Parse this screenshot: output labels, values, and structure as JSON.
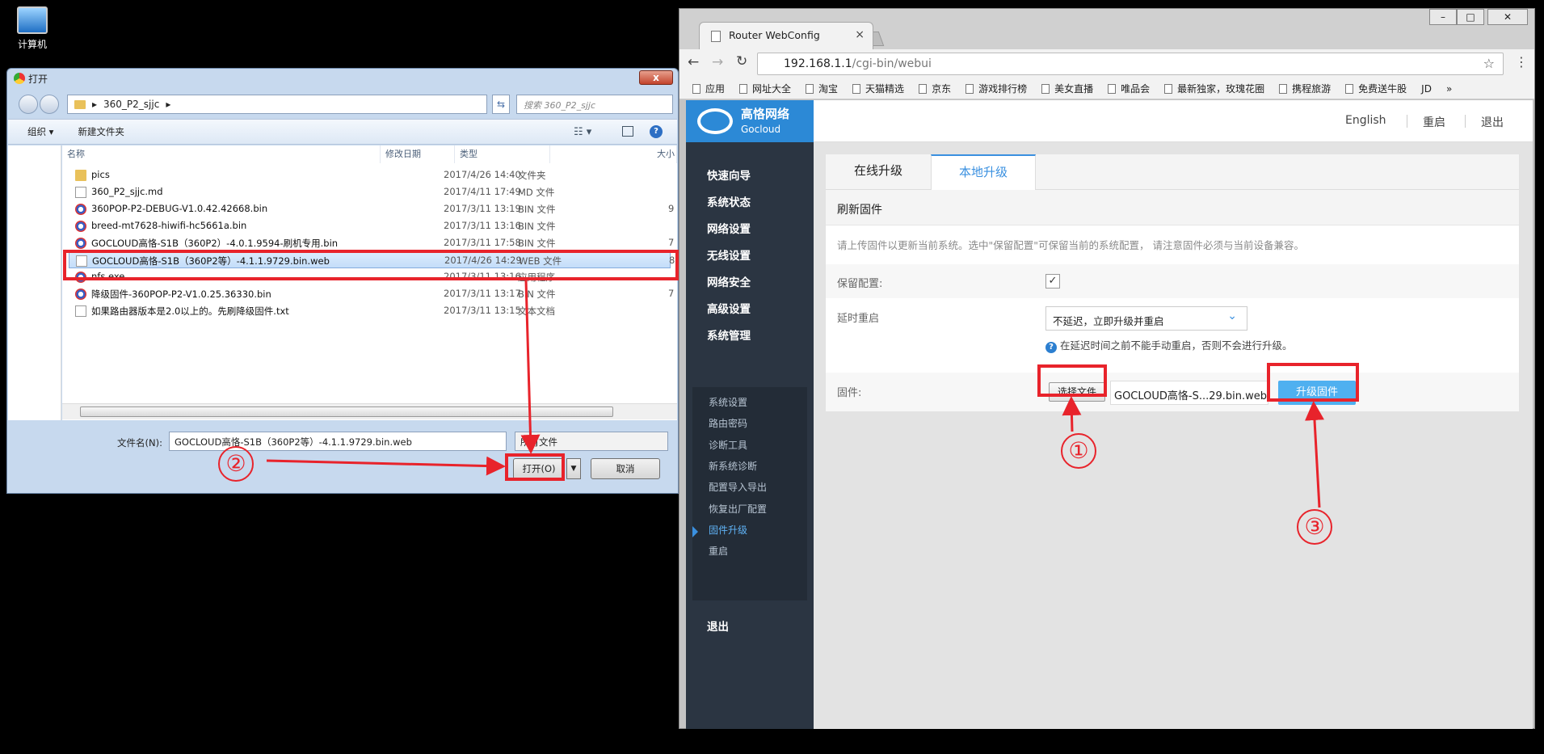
{
  "desktop": {
    "icon_label": "计算机"
  },
  "dialog": {
    "title": "打开",
    "close_glyph": "x",
    "path_label": "360_P2_sjjc",
    "path_sep": "▸",
    "search_placeholder": "搜索 360_P2_sjjc",
    "toolbar": {
      "organize": "组织 ▾",
      "new_folder": "新建文件夹",
      "view_glyph": "☷ ▾",
      "help_glyph": "?"
    },
    "columns": {
      "name": "名称",
      "date": "修改日期",
      "type": "类型",
      "size": "大小"
    },
    "files": [
      {
        "name": "pics",
        "date": "2017/4/26 14:40",
        "type": "文件夹",
        "size": "",
        "icon": "folder"
      },
      {
        "name": "360_P2_sjjc.md",
        "date": "2017/4/11 17:49",
        "type": "MD 文件",
        "size": "",
        "icon": "doc"
      },
      {
        "name": "360POP-P2-DEBUG-V1.0.42.42668.bin",
        "date": "2017/3/11 13:19",
        "type": "BIN 文件",
        "size": "9",
        "icon": "bin"
      },
      {
        "name": "breed-mt7628-hiwifi-hc5661a.bin",
        "date": "2017/3/11 13:16",
        "type": "BIN 文件",
        "size": "",
        "icon": "bin"
      },
      {
        "name": "GOCLOUD高恪-S1B（360P2）-4.0.1.9594-刷机专用.bin",
        "date": "2017/3/11 17:58",
        "type": "BIN 文件",
        "size": "7",
        "icon": "bin"
      },
      {
        "name": "GOCLOUD高恪-S1B（360P2等）-4.1.1.9729.bin.web",
        "date": "2017/4/26 14:29",
        "type": "WEB 文件",
        "size": "8",
        "icon": "doc",
        "selected": true
      },
      {
        "name": "nfs.exe",
        "date": "2017/3/11 13:16",
        "type": "应用程序",
        "size": "",
        "icon": "bin"
      },
      {
        "name": "降级固件-360POP-P2-V1.0.25.36330.bin",
        "date": "2017/3/11 13:17",
        "type": "BIN 文件",
        "size": "7",
        "icon": "bin"
      },
      {
        "name": "如果路由器版本是2.0以上的。先刷降级固件.txt",
        "date": "2017/3/11 13:15",
        "type": "文本文档",
        "size": "",
        "icon": "doc"
      }
    ],
    "filename_label": "文件名(N):",
    "filename_value": "GOCLOUD高恪-S1B（360P2等）-4.1.1.9729.bin.web",
    "filetype_value": "所有文件",
    "open_label": "打开(O)",
    "open_arrow": "▼",
    "cancel_label": "取消"
  },
  "browser": {
    "tab_title": "Router WebConfig",
    "tab_close": "×",
    "url_host": "192.168.1.1",
    "url_path": "/cgi-bin/webui",
    "window_controls": [
      "–",
      "□",
      "✕"
    ],
    "nav": {
      "back": "←",
      "forward": "→",
      "reload": "↻",
      "star": "☆",
      "menu": "⋮"
    },
    "bookmarks": [
      "应用",
      "网址大全",
      "淘宝",
      "天猫精选",
      "京东",
      "游戏排行榜",
      "美女直播",
      "唯品会",
      "最新独家，玫瑰花圈",
      "携程旅游",
      "免费送牛股",
      "JD",
      "»"
    ]
  },
  "router": {
    "logo": {
      "cn": "高恪网络",
      "en": "Gocloud"
    },
    "top_nav": [
      "English",
      "重启",
      "退出"
    ],
    "menu": [
      "快速向导",
      "系统状态",
      "网络设置",
      "无线设置",
      "网络安全",
      "高级设置",
      "系统管理"
    ],
    "submenu": [
      "系统设置",
      "路由密码",
      "诊断工具",
      "新系统诊断",
      "配置导入导出",
      "恢复出厂配置",
      "固件升级",
      "重启"
    ],
    "active_submenu": "固件升级",
    "logout": "退出",
    "tabs": [
      "在线升级",
      "本地升级"
    ],
    "active_tab": "本地升级",
    "section_title": "刷新固件",
    "description": "请上传固件以更新当前系统。选中\"保留配置\"可保留当前的系统配置， 请注意固件必须与当前设备兼容。",
    "keep_config_label": "保留配置:",
    "keep_config_checked": true,
    "checkmark": "✓",
    "delay_label": "延时重启",
    "delay_value": "不延迟，立即升级并重启",
    "delay_chevron": "⌄",
    "delay_hint_icon": "?",
    "delay_hint": "在延迟时间之前不能手动重启，否则不会进行升级。",
    "firmware_label": "固件:",
    "choose_file": "选择文件",
    "file_name": "GOCLOUD高恪-S...29.bin.web",
    "upgrade_button": "升级固件"
  },
  "annotations": {
    "step1": "①",
    "step2": "②",
    "step3": "③"
  },
  "colors": {
    "annotation_red": "#e8232b",
    "accent_blue": "#3a90e0",
    "sidebar": "#2b3542",
    "upgrade_button": "#4fb0f0"
  }
}
